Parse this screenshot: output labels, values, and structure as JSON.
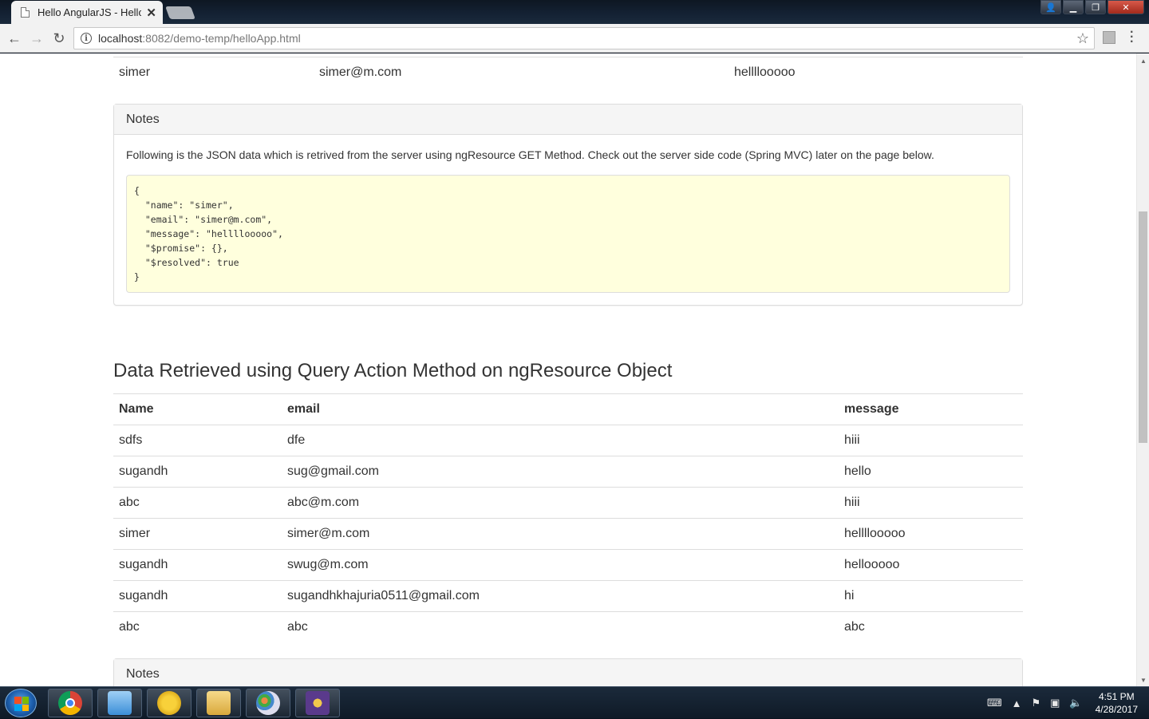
{
  "browser": {
    "tab_title": "Hello AngularJS - Hello W",
    "tab_close": "✕",
    "url_host": "localhost",
    "url_path": ":8082/demo-temp/helloApp.html"
  },
  "page": {
    "top_row": {
      "name": "simer",
      "email": "simer@m.com",
      "message": "hellllooooo"
    },
    "notes_panel": {
      "heading": "Notes",
      "text": "Following is the JSON data which is retrived from the server using ngResource GET Method. Check out the server side code (Spring MVC) later on the page below.",
      "json": "{\n  \"name\": \"simer\",\n  \"email\": \"simer@m.com\",\n  \"message\": \"hellllooooo\",\n  \"$promise\": {},\n  \"$resolved\": true\n}"
    },
    "query_section": {
      "title": "Data Retrieved using Query Action Method on ngResource Object",
      "columns": [
        "Name",
        "email",
        "message"
      ],
      "rows": [
        [
          "sdfs",
          "dfe",
          "hiii"
        ],
        [
          "sugandh",
          "sug@gmail.com",
          "hello"
        ],
        [
          "abc",
          "abc@m.com",
          "hiii"
        ],
        [
          "simer",
          "simer@m.com",
          "hellllooooo"
        ],
        [
          "sugandh",
          "swug@m.com",
          "hellooooo"
        ],
        [
          "sugandh",
          "sugandhkhajuria0511@gmail.com",
          "hi"
        ],
        [
          "abc",
          "abc",
          "abc"
        ]
      ]
    },
    "notes_panel_2": {
      "heading": "Notes"
    }
  },
  "taskbar": {
    "time": "4:51 PM",
    "date": "4/28/2017",
    "apps": [
      {
        "name": "chrome",
        "color": "#db4437"
      },
      {
        "name": "remote-desktop",
        "color": "#3b8ed8"
      },
      {
        "name": "vlc",
        "color": "#f0b400"
      },
      {
        "name": "file-explorer",
        "color": "#e8c262"
      },
      {
        "name": "paint",
        "color": "#5fa5d8"
      },
      {
        "name": "java-ee-ide",
        "color": "#5a3a8c"
      }
    ]
  }
}
